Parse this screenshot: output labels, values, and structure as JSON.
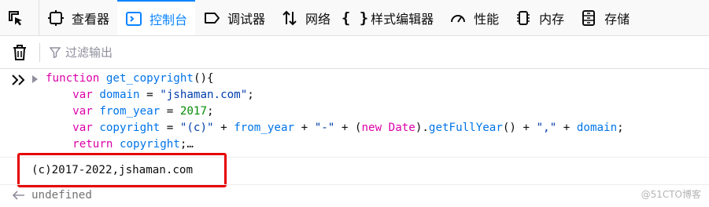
{
  "toolbar": {
    "tabs": [
      {
        "label": "查看器",
        "icon": "inspector-icon"
      },
      {
        "label": "控制台",
        "icon": "console-icon",
        "active": true
      },
      {
        "label": "调试器",
        "icon": "debugger-icon"
      },
      {
        "label": "网络",
        "icon": "network-icon"
      },
      {
        "label": "样式编辑器",
        "icon": "style-editor-icon"
      },
      {
        "label": "性能",
        "icon": "performance-icon"
      },
      {
        "label": "内存",
        "icon": "memory-icon"
      },
      {
        "label": "存储",
        "icon": "storage-icon"
      }
    ]
  },
  "filterbar": {
    "placeholder": "过滤输出"
  },
  "console": {
    "input_lines": [
      "function get_copyright(){",
      "    var domain = \"jshaman.com\";",
      "    var from_year = 2017;",
      "    var copyright = \"(c)\" + from_year + \"-\" + (new Date).getFullYear() + \",\" + domain;",
      "    return copyright;…"
    ],
    "output": "(c)2017-2022,jshaman.com",
    "result": "undefined"
  },
  "watermark": "@51CTO博客",
  "colors": {
    "accent": "#0a84ff",
    "highlight_border": "#e60000",
    "keyword": "#dd00a9",
    "function_name": "#0074e8",
    "string": "#003eaa",
    "number": "#058b00"
  }
}
